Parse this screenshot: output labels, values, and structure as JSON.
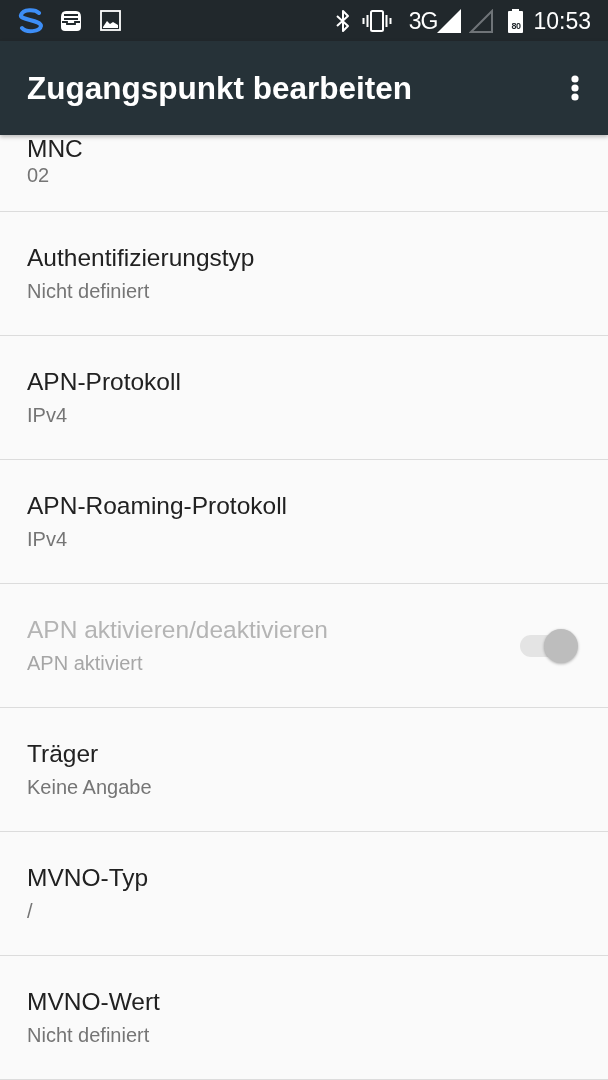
{
  "status_bar": {
    "network_type": "3G",
    "battery_level": "80",
    "time": "10:53"
  },
  "app_bar": {
    "title": "Zugangspunkt bearbeiten"
  },
  "settings": [
    {
      "kind": "text",
      "title": "MNC",
      "value": "02",
      "disabled": false
    },
    {
      "kind": "text",
      "title": "Authentifizierungstyp",
      "value": "Nicht definiert",
      "disabled": false
    },
    {
      "kind": "text",
      "title": "APN-Protokoll",
      "value": "IPv4",
      "disabled": false
    },
    {
      "kind": "text",
      "title": "APN-Roaming-Protokoll",
      "value": "IPv4",
      "disabled": false
    },
    {
      "kind": "switch",
      "title": "APN aktivieren/deaktivieren",
      "value": "APN aktiviert",
      "disabled": true,
      "on": true
    },
    {
      "kind": "text",
      "title": "Träger",
      "value": "Keine Angabe",
      "disabled": false
    },
    {
      "kind": "text",
      "title": "MVNO-Typ",
      "value": "/",
      "disabled": false
    },
    {
      "kind": "text",
      "title": "MVNO-Wert",
      "value": "Nicht definiert",
      "disabled": false
    }
  ]
}
